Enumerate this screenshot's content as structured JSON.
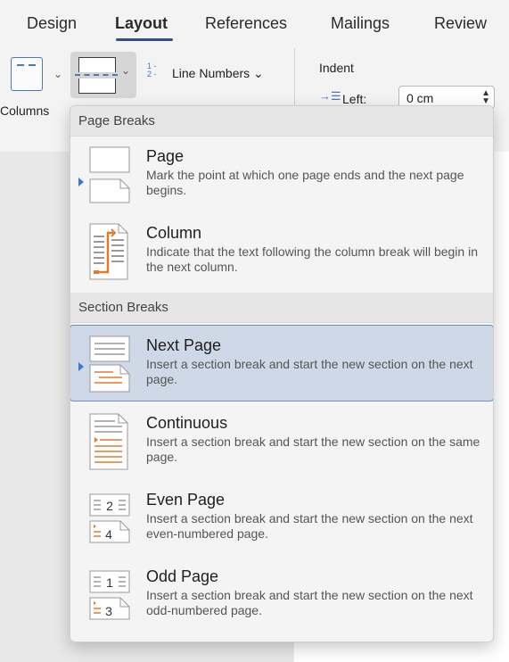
{
  "tabs": [
    {
      "label": "Design"
    },
    {
      "label": "Layout"
    },
    {
      "label": "References"
    },
    {
      "label": "Mailings"
    },
    {
      "label": "Review"
    }
  ],
  "ribbon": {
    "columns_label": "Columns",
    "line_numbers_label": "Line Numbers",
    "line_numbers_icon_text": "1\n2",
    "indent_label": "Indent",
    "left_label": "Left:",
    "left_value": "0 cm"
  },
  "menu": {
    "page_breaks_header": "Page Breaks",
    "section_breaks_header": "Section Breaks",
    "items": [
      {
        "title": "Page",
        "desc": "Mark the point at which one page ends and the next page begins.",
        "icon": "page-break-icon"
      },
      {
        "title": "Column",
        "desc": "Indicate that the text following the column break will begin in the next column.",
        "icon": "column-break-icon"
      },
      {
        "title": "Next Page",
        "desc": "Insert a section break and start the new section on the next page.",
        "icon": "next-page-break-icon"
      },
      {
        "title": "Continuous",
        "desc": "Insert a section break and start the new section on the same page.",
        "icon": "continuous-break-icon"
      },
      {
        "title": "Even Page",
        "desc": "Insert a section break and start the new section on the next even-numbered page.",
        "icon": "even-page-break-icon",
        "num_top": "2",
        "num_bottom": "4"
      },
      {
        "title": "Odd Page",
        "desc": "Insert a section break and start the new section on the next odd-numbered page.",
        "icon": "odd-page-break-icon",
        "num_top": "1",
        "num_bottom": "3"
      }
    ],
    "selected_item": "Next Page"
  },
  "colors": {
    "accent": "#4a78b8",
    "selection_bg": "#cfd8e6",
    "selection_border": "#6f8fbf",
    "orange": "#e07a2e"
  }
}
